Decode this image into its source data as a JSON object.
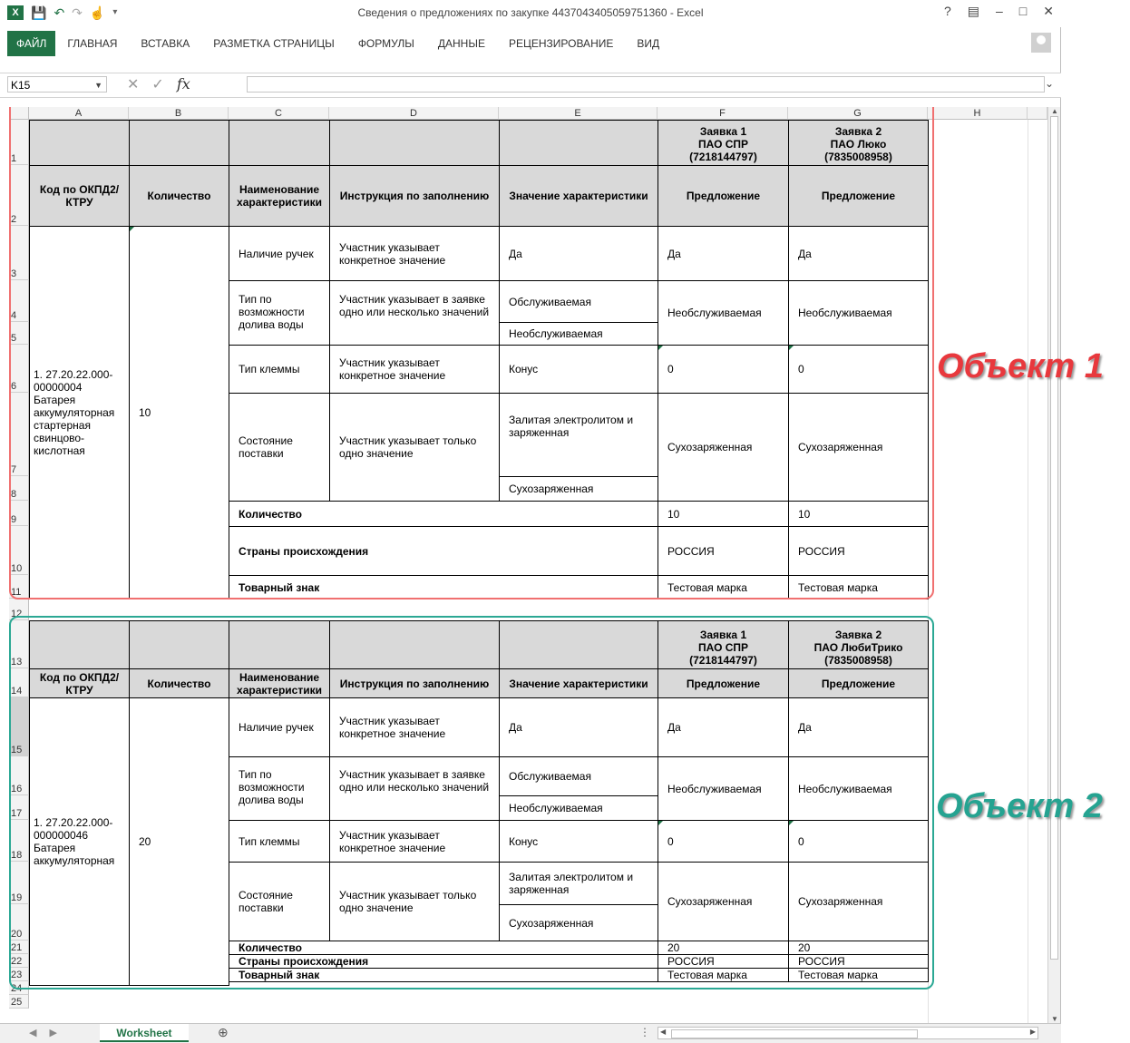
{
  "window": {
    "title": "Сведения о предложениях по закупке 4437043405059751360 - Excel",
    "help": "?",
    "controls": [
      "–",
      "□",
      "✕"
    ]
  },
  "ribbon": {
    "tabs": [
      "ФАЙЛ",
      "ГЛАВНАЯ",
      "ВСТАВКА",
      "РАЗМЕТКА СТРАНИЦЫ",
      "ФОРМУЛЫ",
      "ДАННЫЕ",
      "РЕЦЕНЗИРОВАНИЕ",
      "ВИД"
    ]
  },
  "formula_bar": {
    "name_box": "K15",
    "formula": ""
  },
  "columns": [
    "A",
    "B",
    "C",
    "D",
    "E",
    "F",
    "G",
    "H"
  ],
  "rows": [
    "1",
    "2",
    "3",
    "4",
    "5",
    "6",
    "7",
    "8",
    "9",
    "10",
    "11",
    "12",
    "13",
    "14",
    "15",
    "16",
    "17",
    "18",
    "19",
    "20",
    "21",
    "22",
    "23",
    "24",
    "25"
  ],
  "block1": {
    "label": "Объект 1",
    "app1": "Заявка 1\nПАО СПР\n(7218144797)",
    "app2": "Заявка 2\nПАО Люко\n(7835008958)",
    "h_code": "Код по ОКПД2/КТРУ",
    "h_qty": "Количество",
    "h_name": "Наименование характеристики",
    "h_instr": "Инструкция по заполнению",
    "h_value": "Значение характеристики",
    "h_offer": "Предложение",
    "code": "1. 27.20.22.000-00000004 Батарея аккумуляторная стартерная свинцово-кислотная",
    "qty": "10",
    "c3": "Наличие ручек",
    "d3": "Участник указывает конкретное значение",
    "e3": "Да",
    "f3": "Да",
    "g3": "Да",
    "c4": "Тип по возможности долива воды",
    "d4": "Участник указывает в заявке одно или несколько значений",
    "e4": "Обслуживаемая",
    "e5": "Необслуживаемая",
    "f4": "Необслуживаемая",
    "g4": "Необслуживаемая",
    "c6": "Тип клеммы",
    "d6": "Участник указывает конкретное значение",
    "e6": "Конус",
    "f6": "0",
    "g6": "0",
    "c7": "Состояние поставки",
    "d7": "Участник указывает только одно значение",
    "e7": "Залитая электролитом и заряженная",
    "e8": "Сухозаряженная",
    "f7": "Сухозаряженная",
    "g7": "Сухозаряженная",
    "r9": "Количество",
    "f9": "10",
    "g9": "10",
    "r10": "Страны происхождения",
    "f10": "РОССИЯ",
    "g10": "РОССИЯ",
    "r11": "Товарный знак",
    "f11": "Тестовая марка",
    "g11": "Тестовая марка"
  },
  "block2": {
    "label": "Объект 2",
    "app1": "Заявка 1\nПАО СПР\n(7218144797)",
    "app2": "Заявка 2\nПАО ЛюбиТрико\n(7835008958)",
    "h_code": "Код по ОКПД2/КТРУ",
    "h_qty": "Количество",
    "h_name": "Наименование характеристики",
    "h_instr": "Инструкция по заполнению",
    "h_value": "Значение характеристики",
    "h_offer": "Предложение",
    "code": "1. 27.20.22.000-000000046 Батарея аккумуляторная",
    "qty": "20",
    "c15": "Наличие ручек",
    "d15": "Участник указывает конкретное значение",
    "e15": "Да",
    "f15": "Да",
    "g15": "Да",
    "c16": "Тип по возможности долива воды",
    "d16": "Участник указывает в заявке одно или несколько значений",
    "e16": "Обслуживаемая",
    "e17": "Необслуживаемая",
    "f16": "Необслуживаемая",
    "g16": "Необслуживаемая",
    "c18": "Тип клеммы",
    "d18": "Участник указывает конкретное значение",
    "e18": "Конус",
    "f18": "0",
    "g18": "0",
    "c19": "Состояние поставки",
    "d19": "Участник указывает только одно значение",
    "e19": "Залитая электролитом и заряженная",
    "e20": "Сухозаряженная",
    "f19": "Сухозаряженная",
    "g19": "Сухозаряженная",
    "r21": "Количество",
    "f21": "20",
    "g21": "20",
    "r22": "Страны происхождения",
    "f22": "РОССИЯ",
    "g22": "РОССИЯ",
    "r23": "Товарный знак",
    "f23": "Тестовая марка",
    "g23": "Тестовая марка"
  },
  "sheet_tabs": {
    "active": "Worksheet",
    "add": "⊕"
  }
}
